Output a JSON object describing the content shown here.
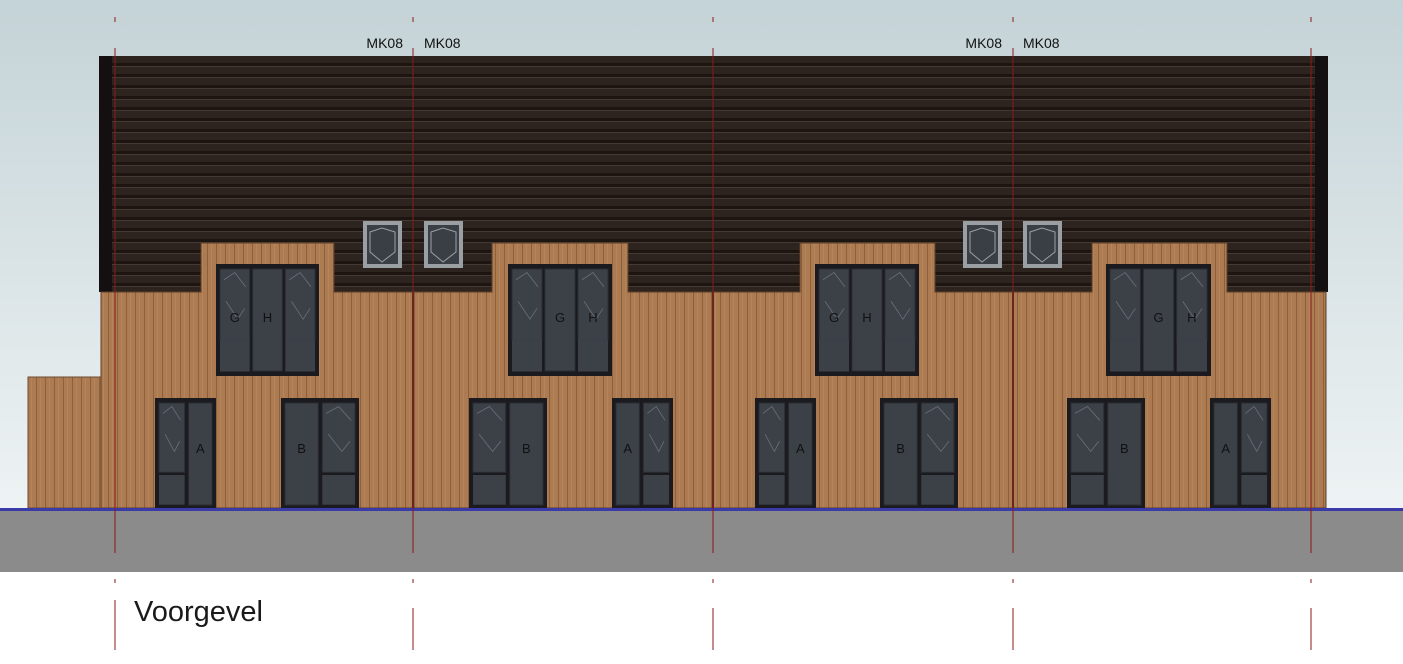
{
  "drawing": {
    "title": "Voorgevel",
    "marker_labels": [
      "MK08",
      "MK08",
      "MK08",
      "MK08"
    ],
    "window_codes": {
      "upper": [
        "G",
        "H",
        "H",
        "G",
        "G",
        "H",
        "H",
        "G"
      ],
      "doors": [
        "A",
        "B",
        "B",
        "A",
        "A",
        "B",
        "B",
        "A"
      ]
    },
    "colors": {
      "sky": "#cdd9dd",
      "roof": "#2b211d",
      "cladding": "#a9774f",
      "frame": "#1b1b1f",
      "glass": "#3c4148",
      "ground": "#8b8b8b",
      "grid_line": "#8b1a1a"
    }
  }
}
